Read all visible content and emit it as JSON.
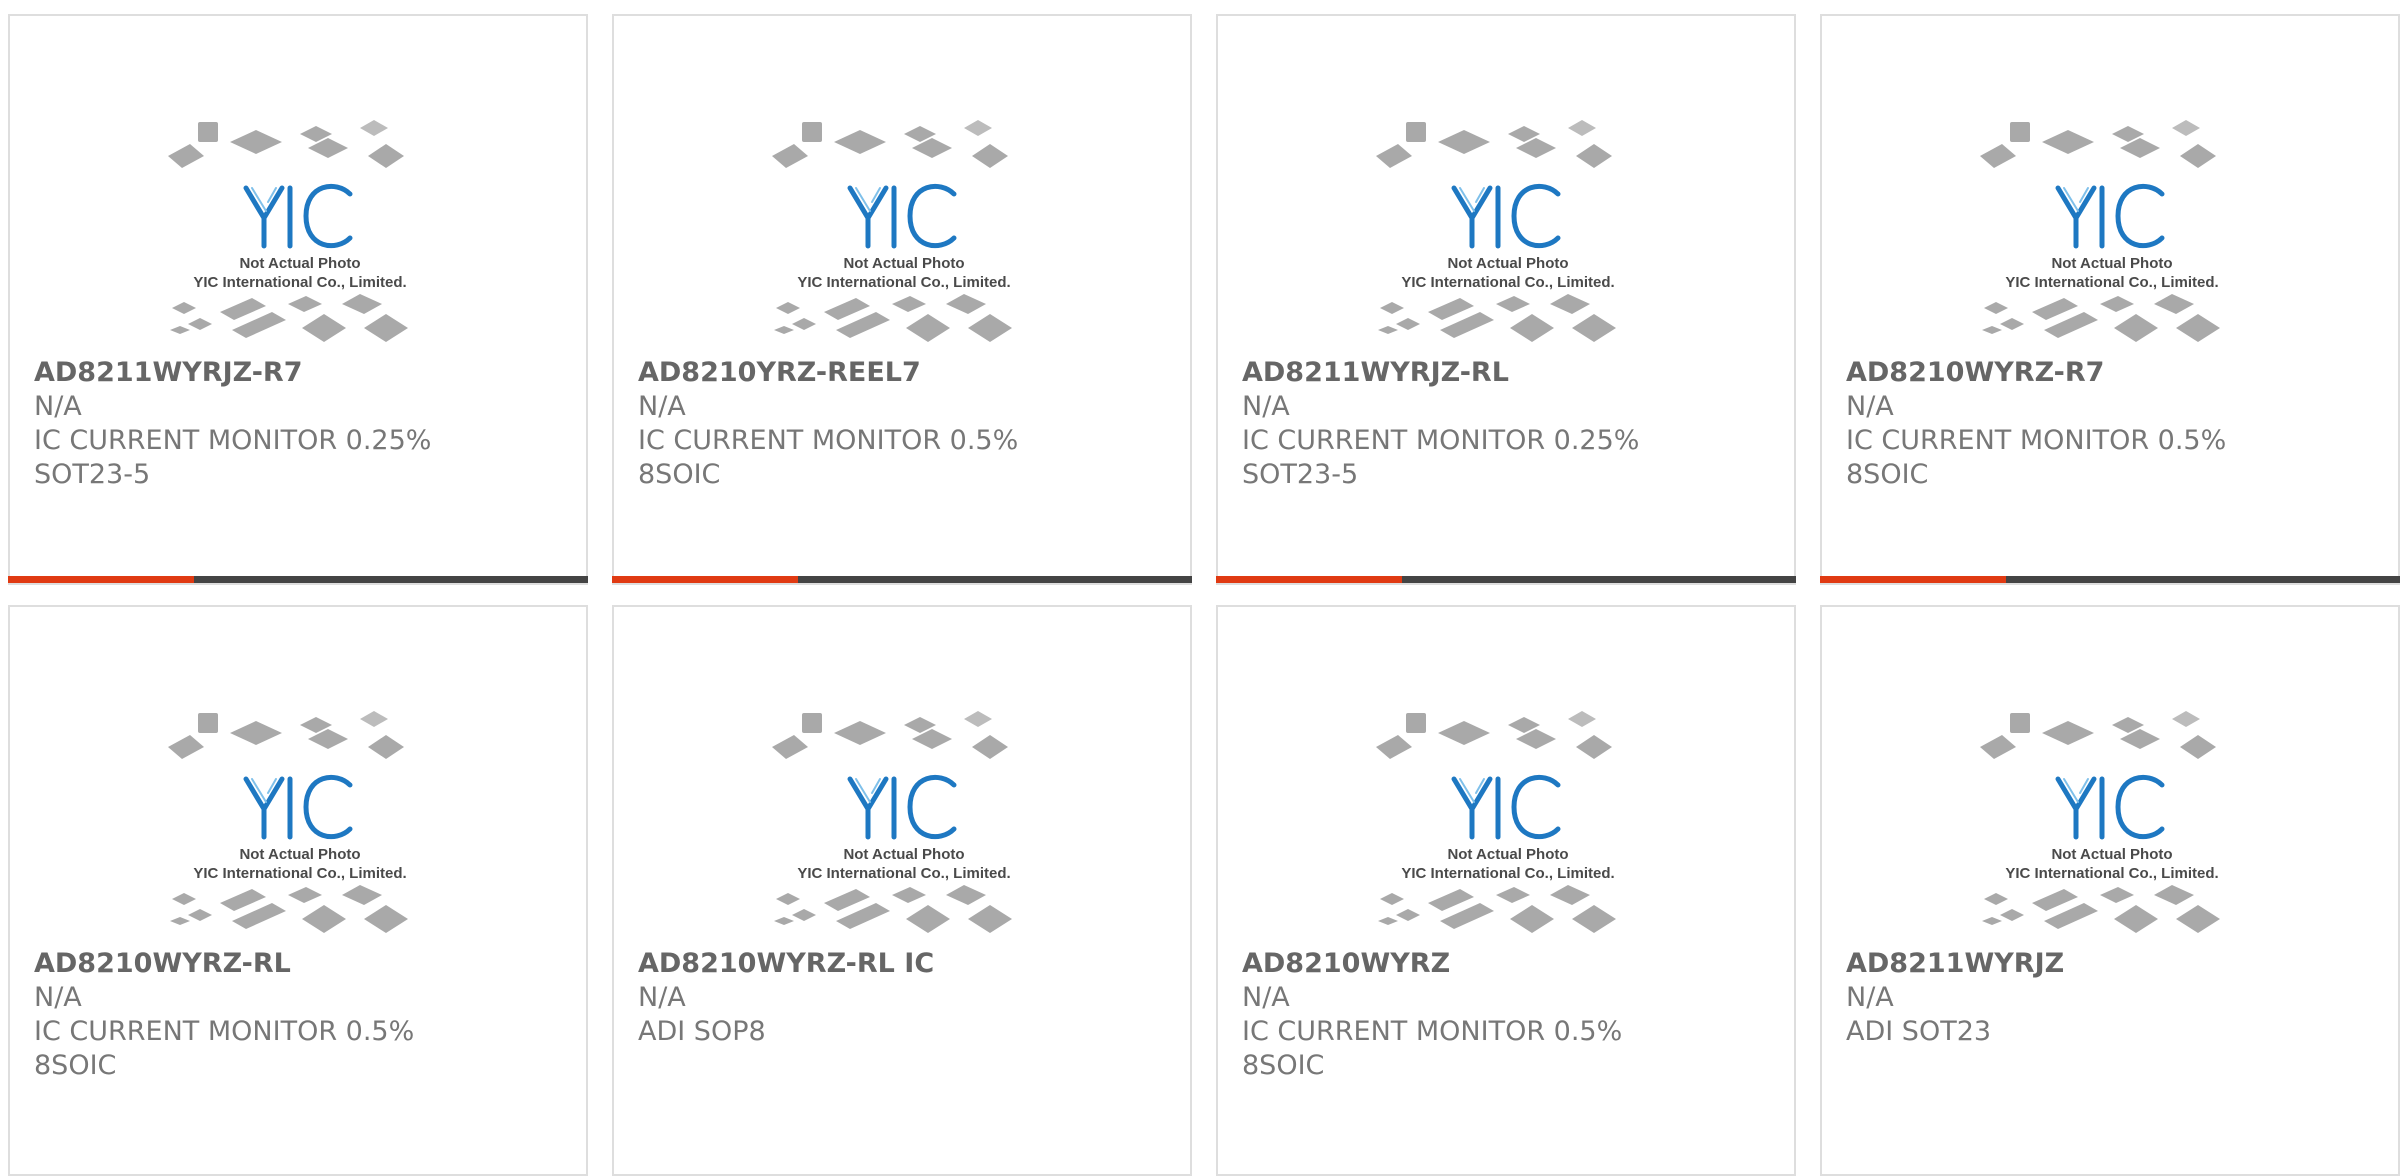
{
  "colors": {
    "progress_fill": "#e03a12",
    "progress_track": "#444444",
    "card_border": "#dedede",
    "logo_blue": "#1e78c2",
    "chip_gray": "#a8a8a8"
  },
  "placeholder": {
    "icon": "yic-chip-placeholder-icon",
    "brand": "YIC",
    "line1": "Not Actual Photo",
    "line2": "YIC International Co., Limited."
  },
  "products": [
    {
      "part": "AD8211WYRJZ-R7",
      "mfr": "N/A",
      "desc": "IC CURRENT MONITOR 0.25%",
      "pkg": "SOT23-5",
      "progress": 0.32
    },
    {
      "part": "AD8210YRZ-REEL7",
      "mfr": "N/A",
      "desc": "IC CURRENT MONITOR 0.5%",
      "pkg": "8SOIC",
      "progress": 0.32
    },
    {
      "part": "AD8211WYRJZ-RL",
      "mfr": "N/A",
      "desc": "IC CURRENT MONITOR 0.25%",
      "pkg": "SOT23-5",
      "progress": 0.32
    },
    {
      "part": "AD8210WYRZ-R7",
      "mfr": "N/A",
      "desc": "IC CURRENT MONITOR 0.5%",
      "pkg": "8SOIC",
      "progress": 0.32
    },
    {
      "part": "AD8210WYRZ-RL",
      "mfr": "N/A",
      "desc": "IC CURRENT MONITOR 0.5%",
      "pkg": "8SOIC",
      "progress": null
    },
    {
      "part": "AD8210WYRZ-RL IC",
      "mfr": "N/A",
      "desc": "ADI SOP8",
      "pkg": "",
      "progress": null
    },
    {
      "part": "AD8210WYRZ",
      "mfr": "N/A",
      "desc": "IC CURRENT MONITOR 0.5%",
      "pkg": "8SOIC",
      "progress": null
    },
    {
      "part": "AD8211WYRJZ",
      "mfr": "N/A",
      "desc": "ADI SOT23",
      "pkg": "",
      "progress": null
    }
  ]
}
